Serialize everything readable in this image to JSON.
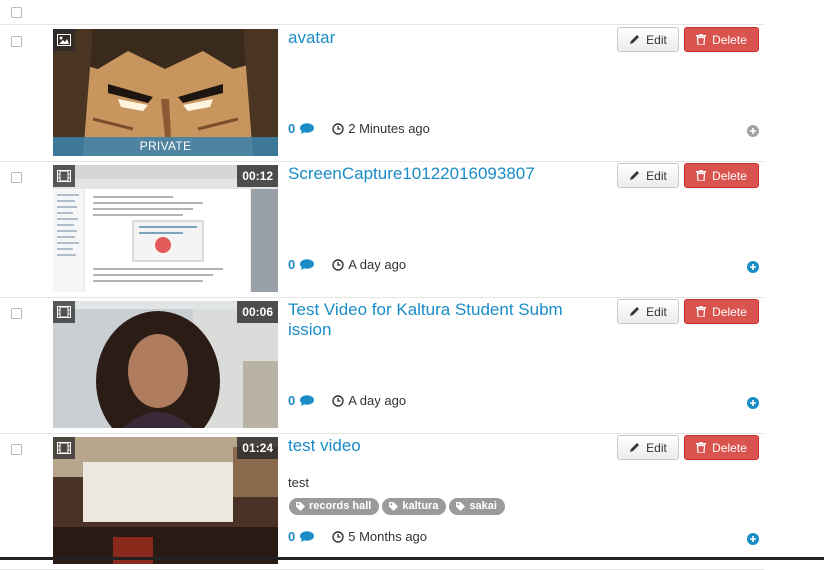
{
  "buttons": {
    "edit_label": "Edit",
    "delete_label": "Delete"
  },
  "colors": {
    "link": "#1a8cc8",
    "delete": "#d9534f",
    "tag": "#9a9a9a",
    "private_band": "#3c82aa"
  },
  "entries": [
    {
      "title": "avatar",
      "type_icon": "image-icon",
      "private_label": "PRIVATE",
      "comments": "0",
      "time": "2 Minutes ago",
      "expand_icon": "expand-plus-icon-gray"
    },
    {
      "title": "ScreenCapture10122016093807",
      "type_icon": "video-icon",
      "duration": "00:12",
      "comments": "0",
      "time": "A day ago",
      "expand_icon": "expand-plus-icon-blue"
    },
    {
      "title": "Test Video for Kaltura Student Submission",
      "type_icon": "video-icon",
      "duration": "00:06",
      "comments": "0",
      "time": "A day ago",
      "expand_icon": "expand-plus-icon-blue"
    },
    {
      "title": "test video",
      "type_icon": "video-icon",
      "duration": "01:24",
      "description": "test",
      "tags": [
        "records hall",
        "kaltura",
        "sakai"
      ],
      "comments": "0",
      "time": "5 Months ago",
      "expand_icon": "expand-plus-icon-blue"
    }
  ]
}
